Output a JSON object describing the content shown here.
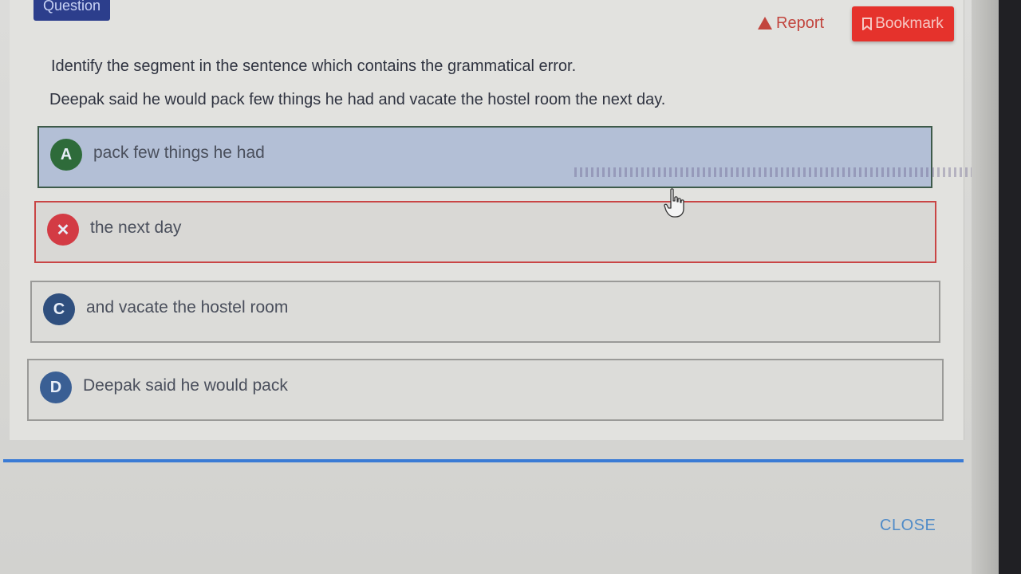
{
  "header": {
    "tag_label": "Question",
    "report_label": "Report",
    "bookmark_label": "Bookmark"
  },
  "question": {
    "prompt": "Identify the segment in the sentence which contains the grammatical error.",
    "sentence": "Deepak said he would pack few things he had and vacate the hostel room the next day."
  },
  "options": [
    {
      "badge": "A",
      "text": "pack few things he had",
      "state": "correct"
    },
    {
      "badge": "✕",
      "text": "the next day",
      "state": "selected-wrong"
    },
    {
      "badge": "C",
      "text": "and vacate the hostel room",
      "state": "neutral"
    },
    {
      "badge": "D",
      "text": "Deepak said he would pack",
      "state": "neutral"
    }
  ],
  "footer": {
    "close_label": "CLOSE"
  },
  "colors": {
    "correct": "#2e6b3a",
    "wrong": "#d33b44",
    "bookmark": "#e5322c",
    "accent_rule": "#3a7bd5"
  },
  "icons": {
    "report": "warning-triangle-icon",
    "bookmark": "bookmark-icon",
    "cursor": "hand-pointer-cursor"
  }
}
